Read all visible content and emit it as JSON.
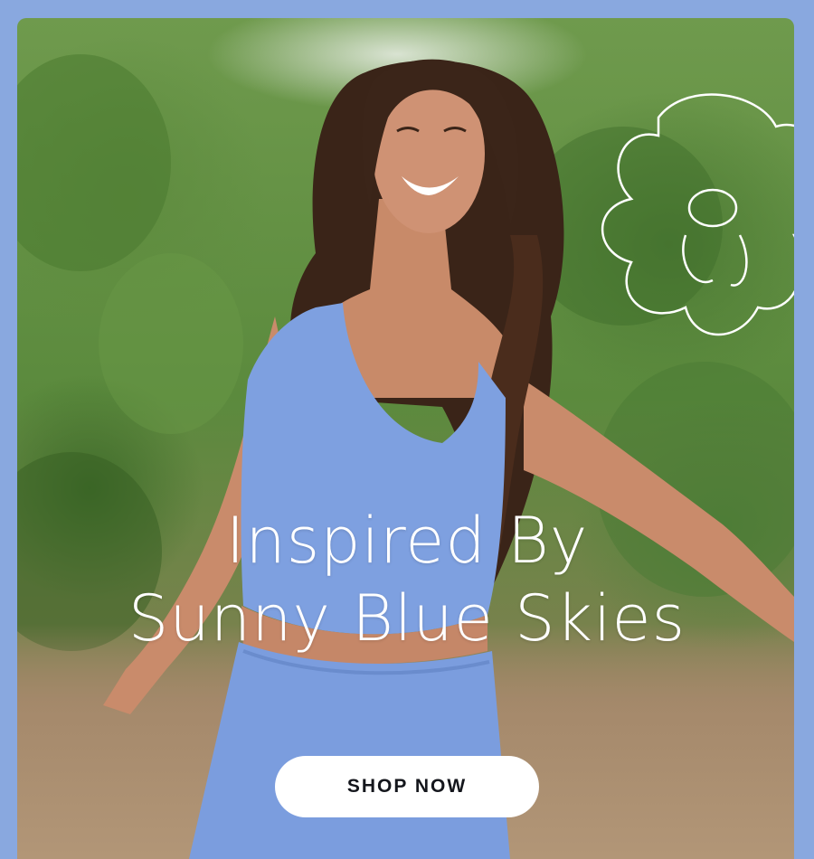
{
  "banner": {
    "headline_line1": "Inspired By",
    "headline_line2": "Sunny Blue Skies",
    "cta_label": "SHOP NOW"
  },
  "colors": {
    "frame": "#89a8df",
    "outfit": "#7ea0e0",
    "cta_bg": "#ffffff",
    "cta_text": "#14161c"
  },
  "icons": {
    "decoration": "flower-outline-icon"
  }
}
